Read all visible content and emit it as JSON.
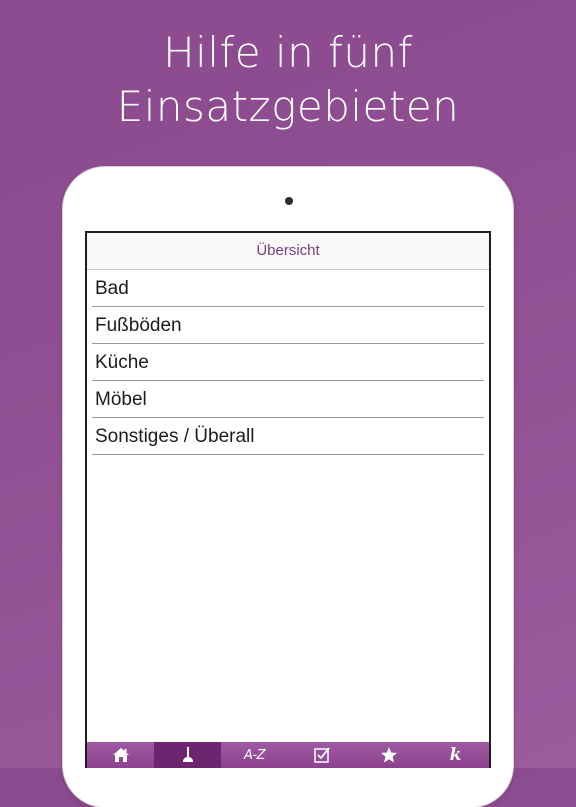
{
  "headline": {
    "line1": "Hilfe in fünf",
    "line2": "Einsatzgebieten"
  },
  "navbar": {
    "title": "Übersicht"
  },
  "list": {
    "items": [
      {
        "label": "Bad"
      },
      {
        "label": "Fußböden"
      },
      {
        "label": "Küche"
      },
      {
        "label": "Möbel"
      },
      {
        "label": "Sonstiges / Überall"
      }
    ]
  },
  "tabbar": {
    "tabs": [
      {
        "icon": "home-icon"
      },
      {
        "icon": "plunger-icon",
        "active": true
      },
      {
        "icon": "az-icon",
        "label": "A-Z"
      },
      {
        "icon": "checkbox-icon"
      },
      {
        "icon": "star-icon"
      },
      {
        "icon": "k-logo-icon",
        "label": "k"
      }
    ]
  },
  "colors": {
    "background": "#8f4f92",
    "accent": "#7d3c80",
    "tabbar": "#9a509c",
    "tab_active": "#6d2570"
  }
}
